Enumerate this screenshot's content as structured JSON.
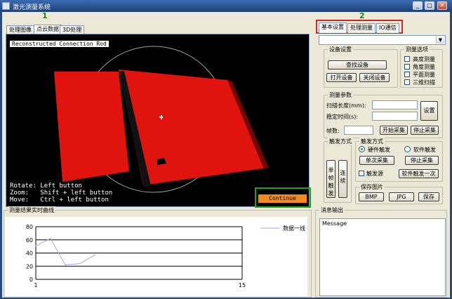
{
  "window": {
    "title": "激光测量系统",
    "min_label": "_",
    "max_label": "□",
    "close_label": "✕"
  },
  "markers": {
    "left": "1",
    "right": "2"
  },
  "left_tabs": [
    {
      "label": "处理图像"
    },
    {
      "label": "点云数据"
    },
    {
      "label": "3D处理"
    }
  ],
  "viewer": {
    "title": "Reconstructed Connection Rod",
    "help_lines": [
      "Rotate: Left button",
      "Zoom:   Shift + left button",
      "Move:   Ctrl + left button"
    ],
    "continue_label": "Continue"
  },
  "right_tabs": [
    {
      "label": "基本设置"
    },
    {
      "label": "处理测量"
    },
    {
      "label": "IO通信"
    }
  ],
  "device_group": {
    "title": "设备设置",
    "find_label": "查找设备",
    "open_label": "打开设备",
    "close_label": "关闭设备"
  },
  "measure_group": {
    "title": "测量选项",
    "items": [
      {
        "label": "高度测量"
      },
      {
        "label": "角度测量"
      },
      {
        "label": "平面测量"
      },
      {
        "label": "三维扫描"
      }
    ]
  },
  "params_group": {
    "title": "测量参数",
    "scan_len_label": "扫描长度(mm):",
    "settle_label": "稳定时间(s):",
    "set_label": "设置",
    "frames_label": "帧数:",
    "start_label": "开始采集",
    "stop_label": "停止采集"
  },
  "trigger_group": {
    "title": "触发方式",
    "vertical_1": "单帧触发",
    "vertical_2": "连续",
    "hw_label": "硬件触发",
    "sw_label": "软件触发",
    "single_label": "单次采集",
    "continuous_label": "停止采集",
    "checkbox_label": "触发源",
    "setting_label": "软件触发一次"
  },
  "save_group": {
    "title": "保存图片",
    "bmp_label": "BMP",
    "jpg_label": "JPG",
    "save_label": "保存"
  },
  "chart_group": {
    "title": "测量结果实时曲线"
  },
  "log_group": {
    "title": "消息输出",
    "text": "Message"
  },
  "chart_data": {
    "type": "line",
    "x": [
      1,
      2,
      3,
      4,
      5
    ],
    "series": [
      {
        "name": "数据一线",
        "values": [
          51,
          62,
          22,
          24,
          37
        ]
      }
    ],
    "xlim": [
      1,
      15
    ],
    "ylim": [
      0,
      80
    ],
    "yticks": [
      0,
      20,
      40,
      60,
      80
    ],
    "xtick_labels": [
      "1",
      "15"
    ],
    "grid": true,
    "legend": "top-right",
    "color": "#a0a8e8"
  }
}
